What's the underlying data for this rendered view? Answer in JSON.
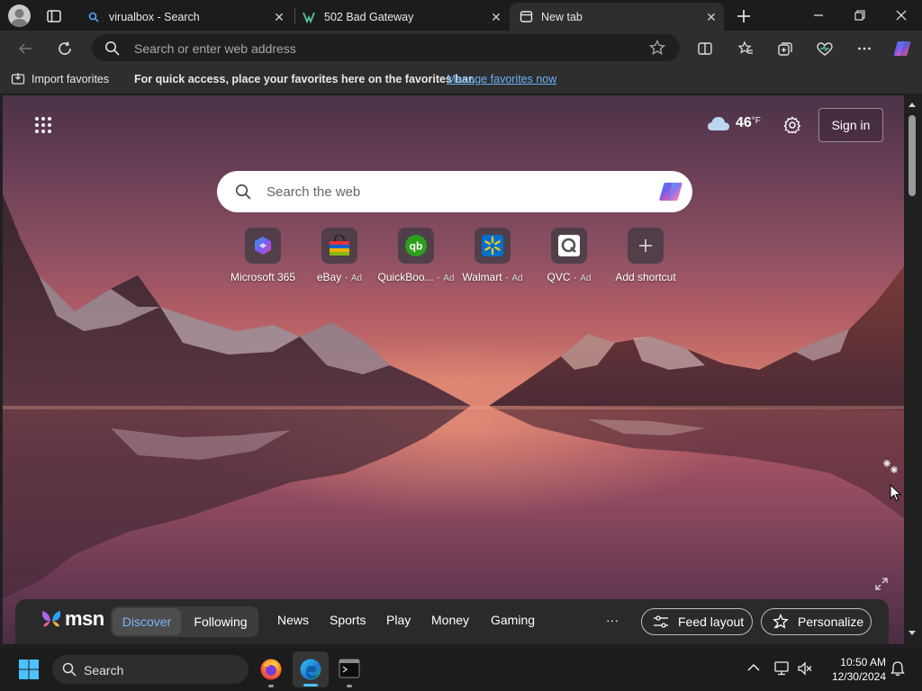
{
  "tabs": [
    {
      "title": "virualbox - Search",
      "icon": "search-favicon"
    },
    {
      "title": "502 Bad Gateway",
      "icon": "vb-favicon"
    },
    {
      "title": "New tab",
      "icon": "newtab-favicon",
      "active": true
    }
  ],
  "toolbar": {
    "address_placeholder": "Search or enter web address"
  },
  "favbar": {
    "import_label": "Import favorites",
    "message": "For quick access, place your favorites here on the favorites bar.",
    "manage_link": "Manage favorites now"
  },
  "newtab": {
    "weather_temp": "46",
    "weather_unit": "°F",
    "sign_in": "Sign in",
    "search_placeholder": "Search the web",
    "shortcuts": [
      {
        "label": "Microsoft 365",
        "ad": ""
      },
      {
        "label": "eBay",
        "ad": "Ad"
      },
      {
        "label": "QuickBoo...",
        "ad": "Ad"
      },
      {
        "label": "Walmart",
        "ad": "Ad"
      },
      {
        "label": "QVC",
        "ad": "Ad"
      },
      {
        "label": "Add shortcut",
        "ad": ""
      }
    ]
  },
  "msn": {
    "logo": "msn",
    "discover": "Discover",
    "following": "Following",
    "nav": [
      "News",
      "Sports",
      "Play",
      "Money",
      "Gaming"
    ],
    "more": "···",
    "feed_layout": "Feed layout",
    "personalize": "Personalize"
  },
  "taskbar": {
    "search_label": "Search",
    "time": "10:50 AM",
    "date": "12/30/2024"
  },
  "colors": {
    "accent_link": "#6cb2f7",
    "chrome_bg": "#2e2e2e",
    "taskbar_bg": "#1c1c1c"
  }
}
